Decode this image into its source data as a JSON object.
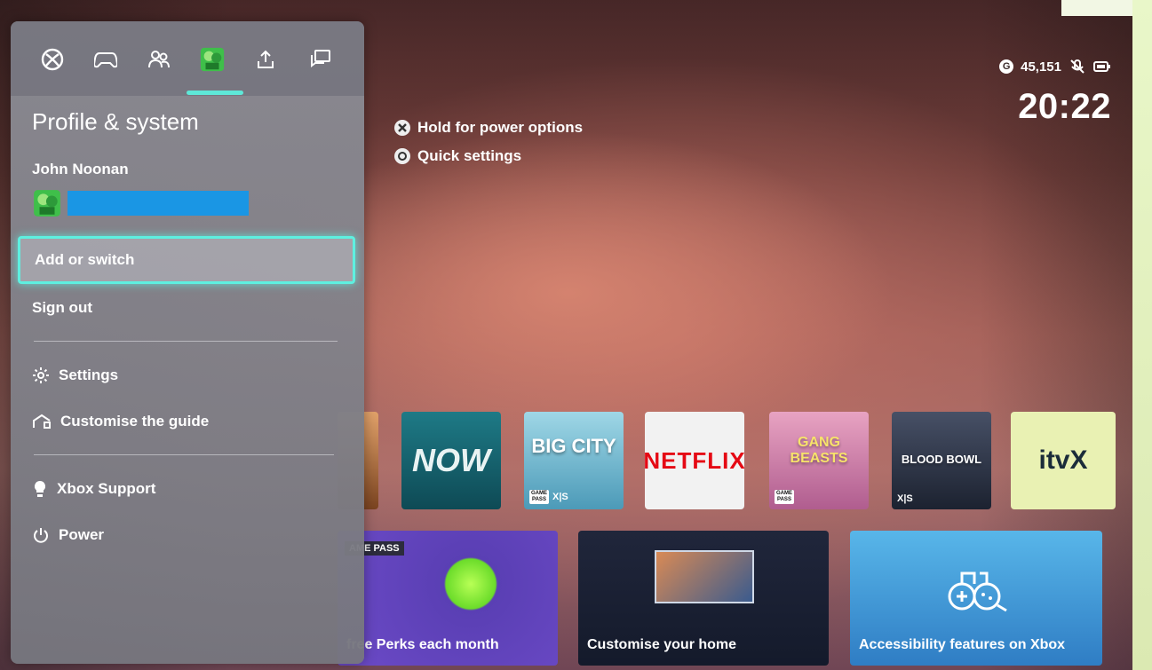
{
  "guide": {
    "tabs": [
      {
        "name": "xbox-tab"
      },
      {
        "name": "controller-tab"
      },
      {
        "name": "people-tab"
      },
      {
        "name": "profile-tab"
      },
      {
        "name": "share-tab"
      },
      {
        "name": "messages-tab"
      }
    ],
    "active_tab": "profile-tab",
    "title": "Profile & system",
    "profile_name": "John Noonan",
    "menu": {
      "add_or_switch": "Add or switch",
      "sign_out": "Sign out",
      "settings": "Settings",
      "customise_guide": "Customise the guide",
      "xbox_support": "Xbox Support",
      "power": "Power"
    }
  },
  "hints": {
    "power": "Hold for power options",
    "quick": "Quick settings"
  },
  "status": {
    "gamerscore": "45,151",
    "gamerscore_badge": "G",
    "time": "20:22"
  },
  "tiles": {
    "now": "NOW",
    "netflix": "NETFLIX",
    "itvx": "itvX",
    "bigcity": "BIG CITY",
    "gangbeasts": "GANG BEASTS",
    "bloodbowl": "BLOOD BOWL",
    "xs_tag": "X|S",
    "gamepass_tag_1": "GAME",
    "gamepass_tag_2": "PASS"
  },
  "cards": {
    "perks_tag": "AME PASS",
    "perks_label": "free Perks each month",
    "home_label": "Customise your home",
    "access_label": "Accessibility features on Xbox"
  },
  "colors": {
    "focus": "#5ef0e0",
    "name_bar": "#1a96e4",
    "avatar_green": "#3fbf4a"
  }
}
